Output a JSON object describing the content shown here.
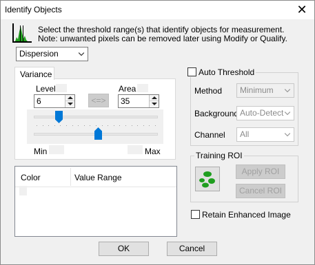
{
  "window": {
    "title": "Identify Objects",
    "close_glyph": "✕"
  },
  "intro": {
    "line1": "Select the threshold range(s) that identify objects for measurement.",
    "line2": "Note: unwanted pixels can be removed later using Modify or Qualify.",
    "icon": "histogram-icon"
  },
  "method_select": {
    "value": "Dispersion"
  },
  "variance": {
    "tab_label": "Variance",
    "level_label": "Level",
    "level_value": "6",
    "area_label": "Area",
    "area_value": "35",
    "swap_label": "<=>",
    "min_label": "Min",
    "max_label": "Max",
    "level_slider_fraction": 0.12,
    "area_slider_fraction": 0.43
  },
  "list": {
    "col_color": "Color",
    "col_range": "Value Range"
  },
  "auto_threshold": {
    "label": "Auto Threshold",
    "checked": false,
    "method_label": "Method",
    "method_value": "Minimum",
    "background_label": "Background",
    "background_value": "Auto-Detect",
    "channel_label": "Channel",
    "channel_value": "All"
  },
  "training_roi": {
    "label": "Training ROI",
    "icon": "roi-blobs-icon",
    "apply_label": "Apply ROI",
    "cancel_label": "Cancel ROI"
  },
  "retain": {
    "label": "Retain Enhanced Image",
    "checked": false
  },
  "footer": {
    "ok_label": "OK",
    "cancel_label": "Cancel"
  },
  "colors": {
    "accent": "#0078d7",
    "roi_green": "#1f9e1f",
    "icon_green": "#22a020"
  }
}
